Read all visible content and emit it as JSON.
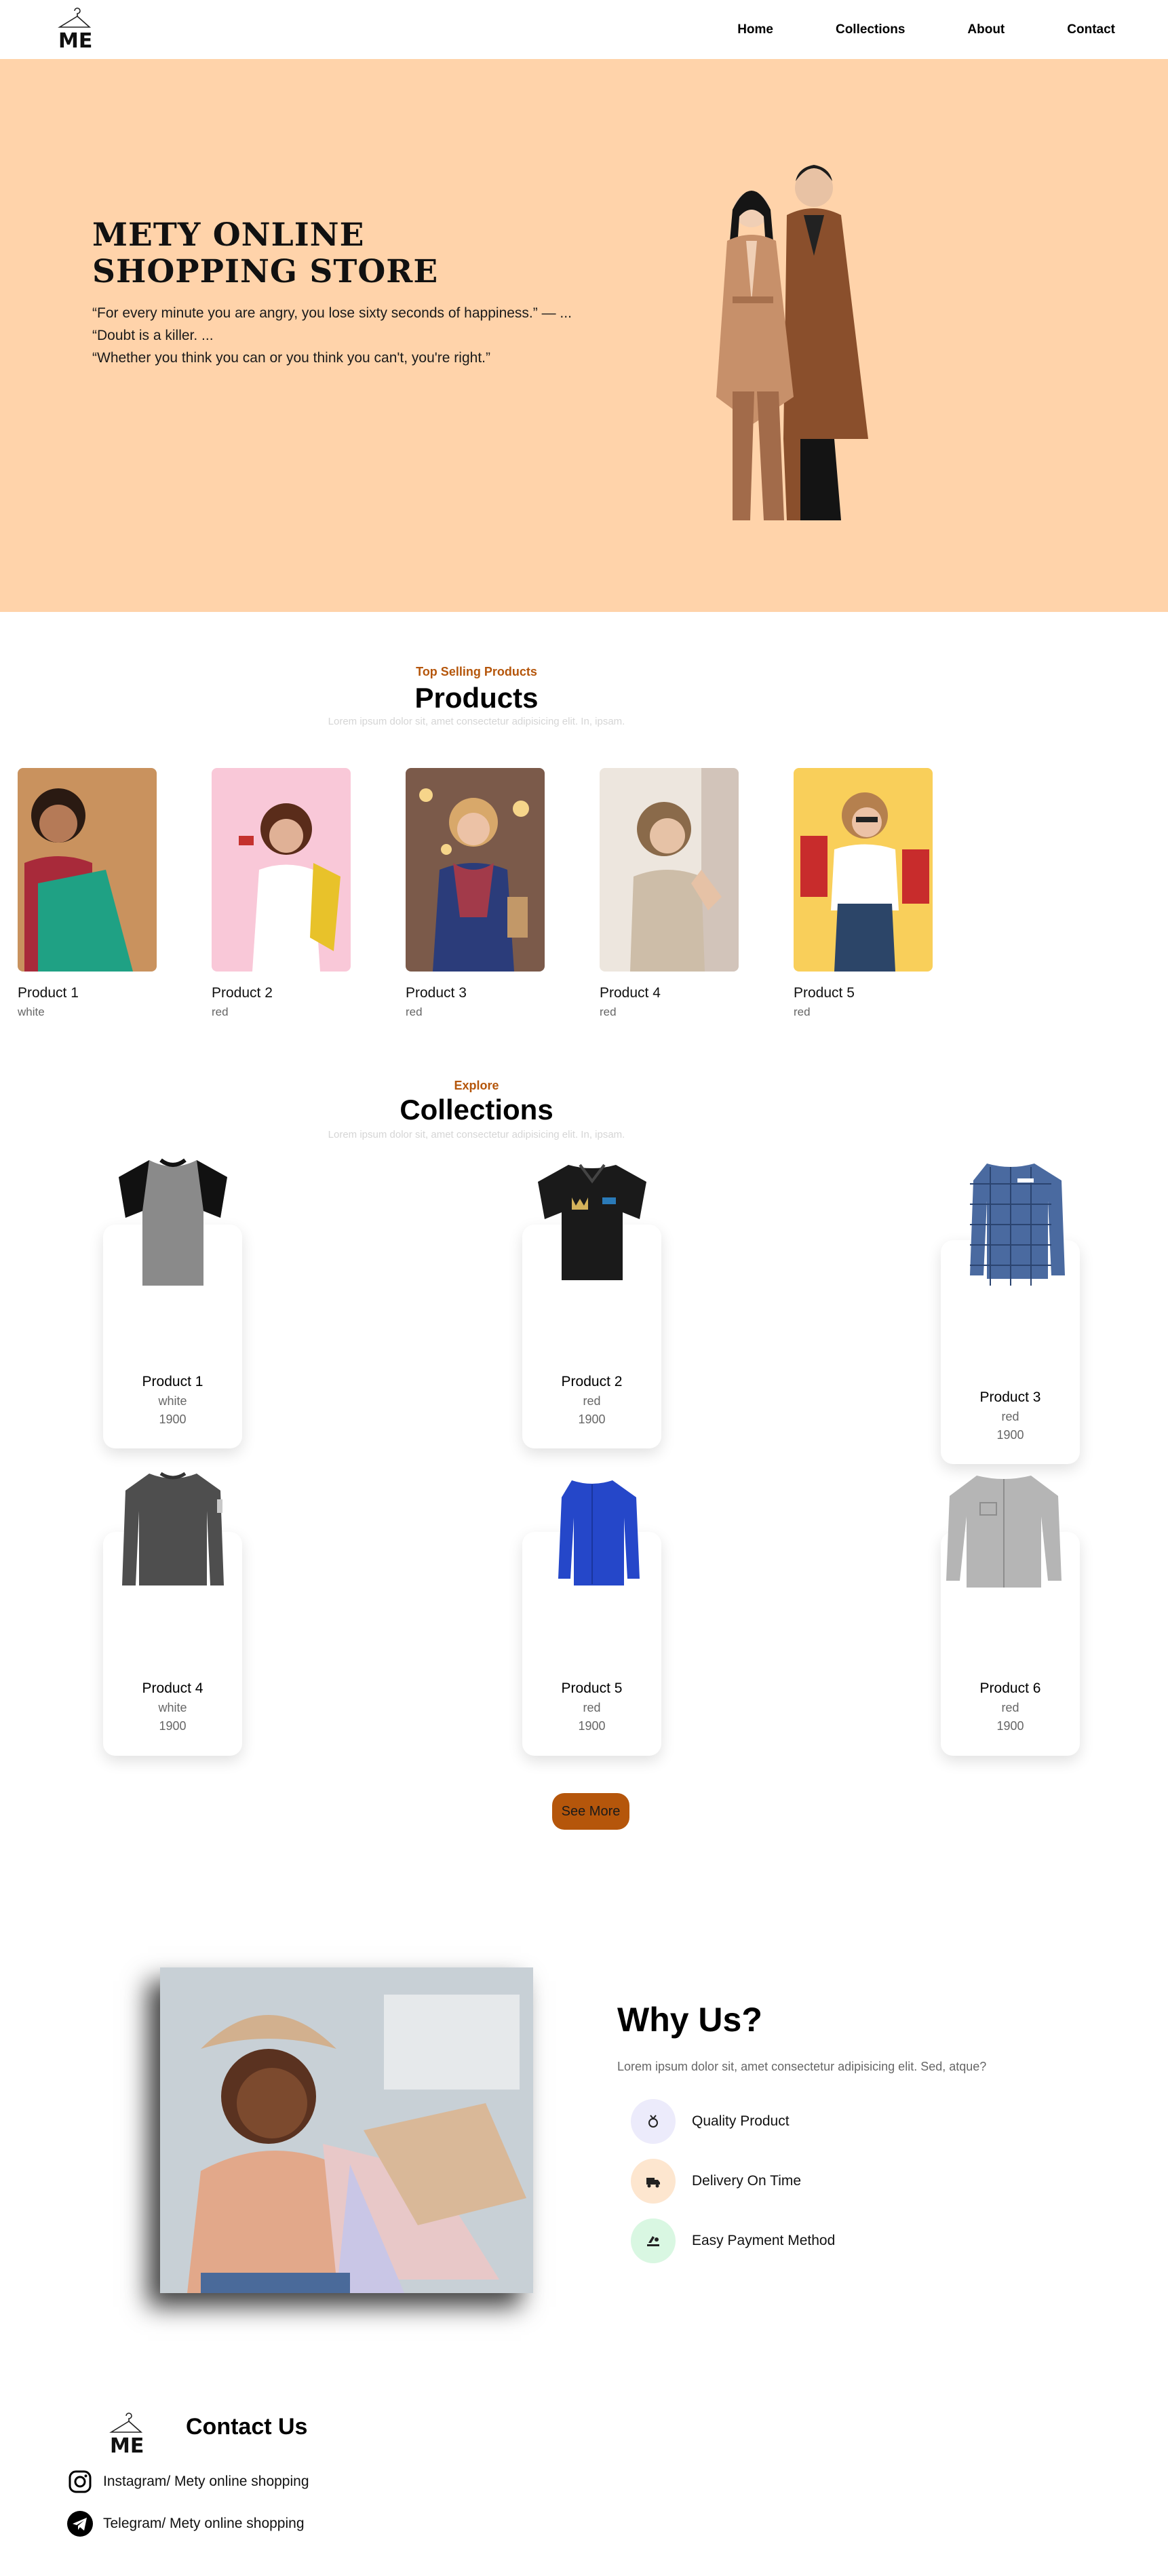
{
  "nav": {
    "logo_icon": "hanger-me-logo",
    "links": [
      "Home",
      "Collections",
      "About",
      "Contact"
    ]
  },
  "hero": {
    "title_line1": "METY ONLINE",
    "title_line2": "SHOPPING STORE",
    "quotes": [
      "“For every minute you are angry, you lose sixty seconds of happiness.” — ...",
      "“Doubt is a killer. ...",
      "“Whether you think you can or you think you can't, you're right.”"
    ],
    "background": "#ffd3aa"
  },
  "products_section": {
    "subtitle": "Top Selling Products",
    "title": "Products",
    "lorem": "Lorem ipsum dolor sit, amet consectetur adipisicing elit. In, ipsam.",
    "items": [
      {
        "name": "Product 1",
        "color": "white"
      },
      {
        "name": "Product 2",
        "color": "red"
      },
      {
        "name": "Product 3",
        "color": "red"
      },
      {
        "name": "Product 4",
        "color": "red"
      },
      {
        "name": "Product 5",
        "color": "red"
      }
    ]
  },
  "collections_section": {
    "subtitle": "Explore",
    "title": "Collections",
    "lorem": "Lorem ipsum dolor sit, amet consectetur adipisicing elit. In, ipsam.",
    "items": [
      {
        "name": "Product 1",
        "color": "white",
        "price": "1900"
      },
      {
        "name": "Product 2",
        "color": "red",
        "price": "1900"
      },
      {
        "name": "Product 3",
        "color": "red",
        "price": "1900"
      },
      {
        "name": "Product 4",
        "color": "white",
        "price": "1900"
      },
      {
        "name": "Product 5",
        "color": "red",
        "price": "1900"
      },
      {
        "name": "Product 6",
        "color": "red",
        "price": "1900"
      }
    ],
    "see_more_label": "See More",
    "accent": "#b5560b"
  },
  "why_us": {
    "title": "Why Us?",
    "lorem": "Lorem ipsum dolor sit, amet consectetur adipisicing elit. Sed, atque?",
    "items": [
      {
        "label": "Quality Product",
        "icon": "medal-icon",
        "bg": "#ecebfb"
      },
      {
        "label": "Delivery On Time",
        "icon": "delivery-icon",
        "bg": "#fde6cf"
      },
      {
        "label": "Easy Payment Method",
        "icon": "payment-icon",
        "bg": "#d9f7e2"
      }
    ]
  },
  "contact": {
    "title": "Contact Us",
    "instagram": "Instagram/ Mety online shopping",
    "telegram": "Telegram/ Mety online shopping"
  }
}
